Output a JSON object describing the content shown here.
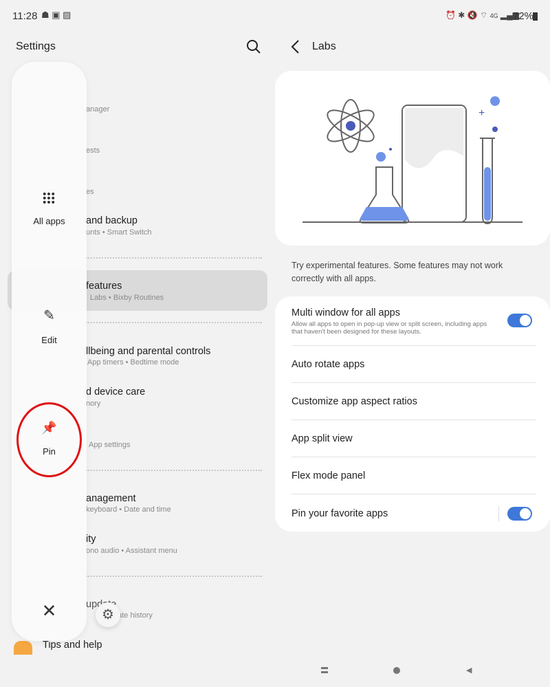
{
  "status_bar": {
    "time": "11:28",
    "battery": "72%",
    "network": "4G"
  },
  "left": {
    "title": "Settings",
    "items": [
      {
        "title": "",
        "sub": "anager"
      },
      {
        "title": "",
        "sub": "ests"
      },
      {
        "title": "",
        "sub": "es"
      },
      {
        "title": "and backup",
        "sub": "unts  •  Smart Switch"
      },
      {
        "title": "features",
        "sub": "Labs  •  Bixby Routines"
      },
      {
        "title": "llbeing and parental controls",
        "sub": "App timers  •  Bedtime mode"
      },
      {
        "title": "d device care",
        "sub": "nory"
      },
      {
        "title": "",
        "sub": "App settings"
      },
      {
        "title": "anagement",
        "sub": "keyboard  •  Date and time"
      },
      {
        "title": "ity",
        "sub": "ono audio  •  Assistant menu"
      },
      {
        "title": "update",
        "sub": "date history"
      },
      {
        "title": "Tips and help",
        "sub": ""
      }
    ]
  },
  "edge_panel": {
    "all_apps": "All apps",
    "edit": "Edit",
    "pin": "Pin"
  },
  "right": {
    "title": "Labs",
    "description": "Try experimental features. Some features may not work correctly with all apps.",
    "options": [
      {
        "label": "Multi window for all apps",
        "sub": "Allow all apps to open in pop-up view or split screen, including apps that haven't been designed for these layouts.",
        "toggle": true
      },
      {
        "label": "Auto rotate apps"
      },
      {
        "label": "Customize app aspect ratios"
      },
      {
        "label": "App split view"
      },
      {
        "label": "Flex mode panel"
      },
      {
        "label": "Pin your favorite apps",
        "toggle": true
      }
    ]
  },
  "colors": {
    "accent": "#3e78d8",
    "highlight_circle": "#e01010",
    "tips_icon": "#f5a742"
  }
}
